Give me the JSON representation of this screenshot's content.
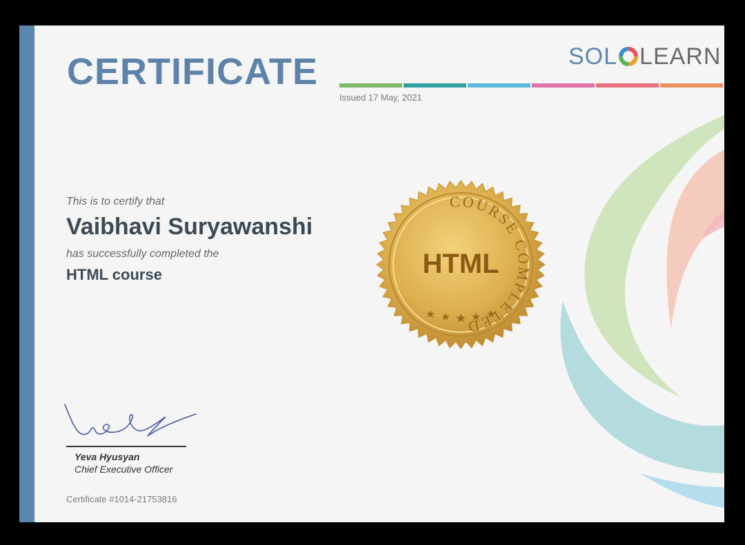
{
  "certificate": {
    "title": "CERTIFICATE",
    "issued": "Issued 17 May, 2021",
    "certify_text": "This is to certify that",
    "recipient_name": "Vaibhavi Suryawanshi",
    "completed_text": "has successfully completed the",
    "course_name": "HTML course",
    "certificate_number": "Certificate #1014-21753816"
  },
  "logo": {
    "part1": "SOL",
    "part2": "LEARN"
  },
  "seal": {
    "ring_text": "COURSE COMPLETED",
    "center_text": "HTML"
  },
  "signatory": {
    "name": "Yeva Hyusyan",
    "title": "Chief Executive Officer"
  },
  "colors": {
    "accent_blue": "#5b86ad",
    "stripes": [
      "#7dbb6a",
      "#2e9f9f",
      "#5bb7dc",
      "#e072a8",
      "#e8707a",
      "#e8905e"
    ],
    "seal_gold": "#d9a948"
  }
}
